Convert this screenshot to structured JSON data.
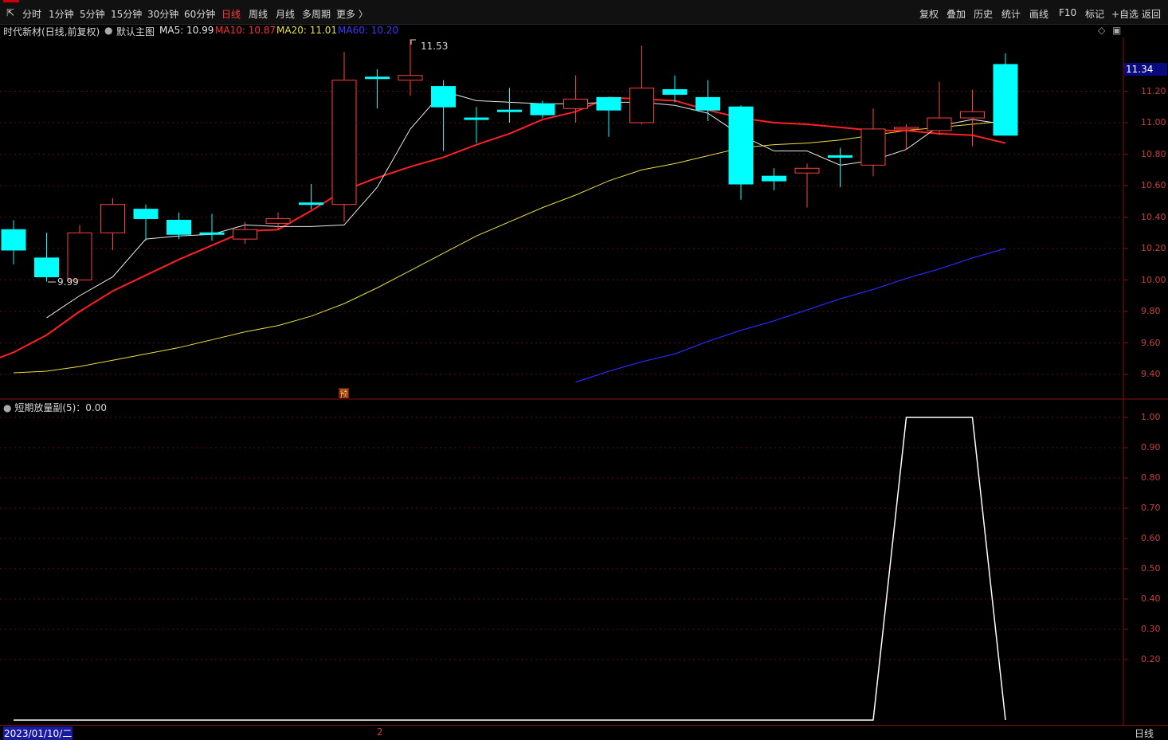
{
  "toolbar": {
    "periods": [
      "分时",
      "1分钟",
      "5分钟",
      "15分钟",
      "30分钟",
      "60分钟",
      "日线",
      "周线",
      "月线",
      "多周期",
      "更多 〉"
    ],
    "active_period": "日线",
    "right_items": [
      "复权",
      "叠加",
      "历史",
      "统计",
      "画线",
      "F10",
      "标记",
      "+自选",
      "返回"
    ]
  },
  "main_title": {
    "stock": "时代新材(日线,前复权)",
    "template": "默认主图",
    "ma5": "MA5: 10.99",
    "ma10": "MA10: 10.87",
    "ma20": "MA20: 11.01",
    "ma60": "MA60: 10.20"
  },
  "colors": {
    "ma5": "#e8e8e8",
    "ma10": "#ff2020",
    "ma20": "#e8e040",
    "ma60": "#2a2aff",
    "up": "#ff4040",
    "down": "#00ffff"
  },
  "price_axis": {
    "labels": [
      "11.20",
      "11.00",
      "10.80",
      "10.60",
      "10.40",
      "10.20",
      "10.00",
      "9.80",
      "9.60",
      "9.40"
    ],
    "current": "11.34"
  },
  "annotations": {
    "high": "11.53",
    "low": "9.99",
    "yu": "预"
  },
  "sub_title": "短期放量副(5)：0.00",
  "sub_axis": {
    "labels": [
      "1.00",
      "0.90",
      "0.80",
      "0.70",
      "0.60",
      "0.50",
      "0.40",
      "0.30",
      "0.20"
    ]
  },
  "bottom": {
    "date": "2023/01/10/二",
    "marker": "2",
    "period": "日线"
  },
  "chart_data": {
    "type": "candlestick",
    "candles": [
      {
        "o": 10.32,
        "c": 10.19,
        "h": 10.38,
        "l": 10.1
      },
      {
        "o": 10.14,
        "c": 10.02,
        "h": 10.3,
        "l": 9.99
      },
      {
        "o": 10.0,
        "c": 10.3,
        "h": 10.35,
        "l": 10.0
      },
      {
        "o": 10.3,
        "c": 10.48,
        "h": 10.52,
        "l": 10.19
      },
      {
        "o": 10.45,
        "c": 10.39,
        "h": 10.48,
        "l": 10.25
      },
      {
        "o": 10.38,
        "c": 10.29,
        "h": 10.43,
        "l": 10.26
      },
      {
        "o": 10.3,
        "c": 10.29,
        "h": 10.42,
        "l": 10.25
      },
      {
        "o": 10.26,
        "c": 10.32,
        "h": 10.37,
        "l": 10.23
      },
      {
        "o": 10.36,
        "c": 10.39,
        "h": 10.43,
        "l": 10.32
      },
      {
        "o": 10.49,
        "c": 10.48,
        "h": 10.61,
        "l": 10.45
      },
      {
        "o": 10.48,
        "c": 11.27,
        "h": 11.45,
        "l": 10.37
      },
      {
        "o": 11.29,
        "c": 11.28,
        "h": 11.34,
        "l": 11.09
      },
      {
        "o": 11.27,
        "c": 11.3,
        "h": 11.53,
        "l": 11.17
      },
      {
        "o": 11.23,
        "c": 11.1,
        "h": 11.27,
        "l": 10.82
      },
      {
        "o": 11.03,
        "c": 11.02,
        "h": 11.1,
        "l": 10.87
      },
      {
        "o": 11.08,
        "c": 11.07,
        "h": 11.22,
        "l": 11.0
      },
      {
        "o": 11.12,
        "c": 11.05,
        "h": 11.14,
        "l": 11.03
      },
      {
        "o": 11.09,
        "c": 11.15,
        "h": 11.3,
        "l": 11.0
      },
      {
        "o": 11.16,
        "c": 11.08,
        "h": 11.16,
        "l": 10.91
      },
      {
        "o": 11.0,
        "c": 11.22,
        "h": 11.49,
        "l": 10.99
      },
      {
        "o": 11.21,
        "c": 11.18,
        "h": 11.3,
        "l": 11.13
      },
      {
        "o": 11.16,
        "c": 11.08,
        "h": 11.27,
        "l": 11.01
      },
      {
        "o": 11.1,
        "c": 10.61,
        "h": 11.11,
        "l": 10.51
      },
      {
        "o": 10.66,
        "c": 10.63,
        "h": 10.71,
        "l": 10.57
      },
      {
        "o": 10.68,
        "c": 10.71,
        "h": 10.74,
        "l": 10.46
      },
      {
        "o": 10.79,
        "c": 10.78,
        "h": 10.84,
        "l": 10.59
      },
      {
        "o": 10.73,
        "c": 10.96,
        "h": 11.09,
        "l": 10.66
      },
      {
        "o": 10.96,
        "c": 10.97,
        "h": 10.99,
        "l": 10.83
      },
      {
        "o": 10.95,
        "c": 11.03,
        "h": 11.26,
        "l": 10.92
      },
      {
        "o": 11.03,
        "c": 11.07,
        "h": 11.21,
        "l": 10.85
      },
      {
        "o": 11.37,
        "c": 10.92,
        "h": 11.44,
        "l": 10.92
      }
    ],
    "ma5": [
      9.76,
      9.9,
      10.02,
      10.26,
      10.28,
      10.29,
      10.35,
      10.34,
      10.34,
      10.35,
      10.59,
      10.96,
      11.2,
      11.14,
      11.13,
      11.12,
      11.12,
      11.13,
      11.13,
      11.11,
      11.06,
      10.92,
      10.82,
      10.82,
      10.73,
      10.76,
      10.83,
      10.98,
      11.02,
      10.99
    ],
    "ma10": [
      9.46,
      9.54,
      9.65,
      9.8,
      9.93,
      10.03,
      10.13,
      10.22,
      10.31,
      10.32,
      10.44,
      10.57,
      10.65,
      10.72,
      10.78,
      10.86,
      10.93,
      11.02,
      11.07,
      11.16,
      11.15,
      11.14,
      11.08,
      11.03,
      11.0,
      10.99,
      10.97,
      10.95,
      10.95,
      10.93,
      10.92,
      10.87
    ],
    "ma20": [
      9.41,
      9.42,
      9.45,
      9.49,
      9.53,
      9.57,
      9.62,
      9.67,
      9.71,
      9.77,
      9.85,
      9.95,
      10.06,
      10.17,
      10.28,
      10.37,
      10.46,
      10.54,
      10.63,
      10.7,
      10.74,
      10.79,
      10.84,
      10.86,
      10.87,
      10.89,
      10.92,
      10.95,
      10.97,
      10.99,
      11.01
    ],
    "ma60": [
      9.35,
      9.42,
      9.48,
      9.53,
      9.61,
      9.68,
      9.74,
      9.81,
      9.88,
      9.94,
      10.01,
      10.07,
      10.14,
      10.2
    ],
    "sub": [
      0,
      0,
      0,
      0,
      0,
      0,
      0,
      0,
      0,
      0,
      0,
      0,
      0,
      0,
      0,
      0,
      0,
      0,
      0,
      0,
      0,
      0,
      0,
      0,
      0,
      0,
      0,
      1,
      1,
      1,
      0
    ]
  }
}
